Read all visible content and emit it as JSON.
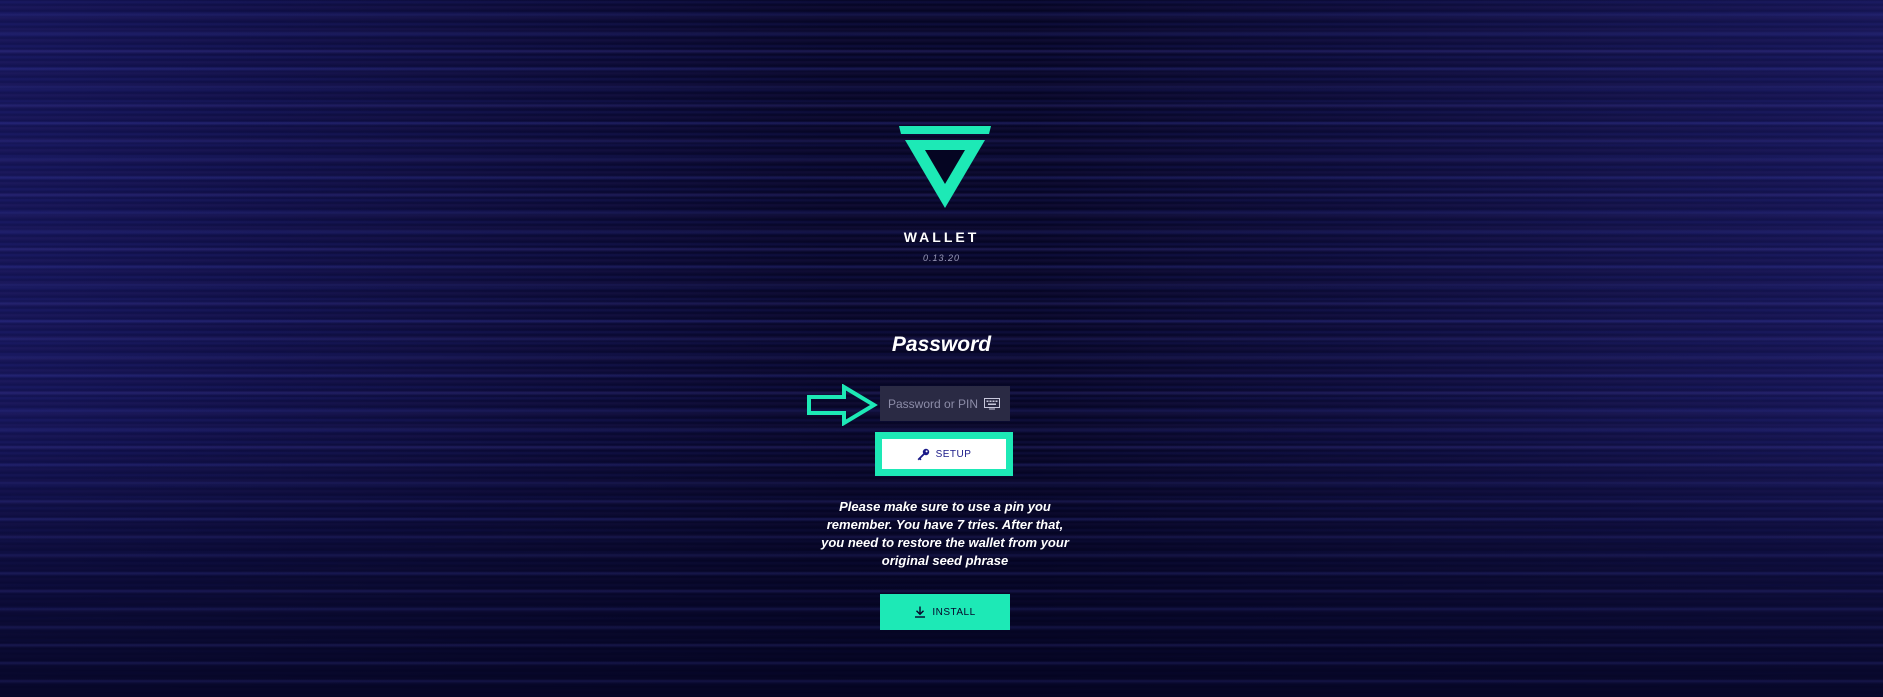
{
  "app": {
    "brand": "WALLET",
    "version": "0.13.20",
    "accent_color": "#1de9b6",
    "background_color": "#050522"
  },
  "login": {
    "title": "Password",
    "password_field": {
      "placeholder": "Password or PIN",
      "value": "",
      "icon": "keyboard-icon"
    },
    "setup_button": {
      "label": "SETUP",
      "icon": "key-icon"
    },
    "info_text": "Please make sure to use a pin you remember. You have 7 tries. After that, you need to restore the wallet from your original seed phrase",
    "install_button": {
      "label": "INSTALL",
      "icon": "download-icon"
    }
  }
}
